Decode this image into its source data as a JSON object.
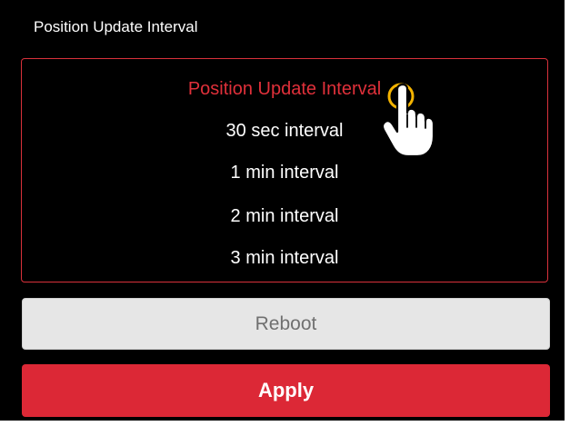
{
  "screen": {
    "title": "Position Update Interval"
  },
  "picker": {
    "header": "Position Update Interval",
    "options": [
      "30 sec interval",
      "1 min interval",
      "2 min interval",
      "3 min interval"
    ]
  },
  "buttons": {
    "reboot_label": "Reboot",
    "apply_label": "Apply"
  },
  "icons": {
    "pointer": "hand-pointer-icon"
  },
  "colors": {
    "background": "#000000",
    "accent_red": "#dc2836",
    "picker_border": "#d9313b",
    "reboot_bg": "#e6e6e6",
    "cursor_highlight": "#f5b400"
  }
}
